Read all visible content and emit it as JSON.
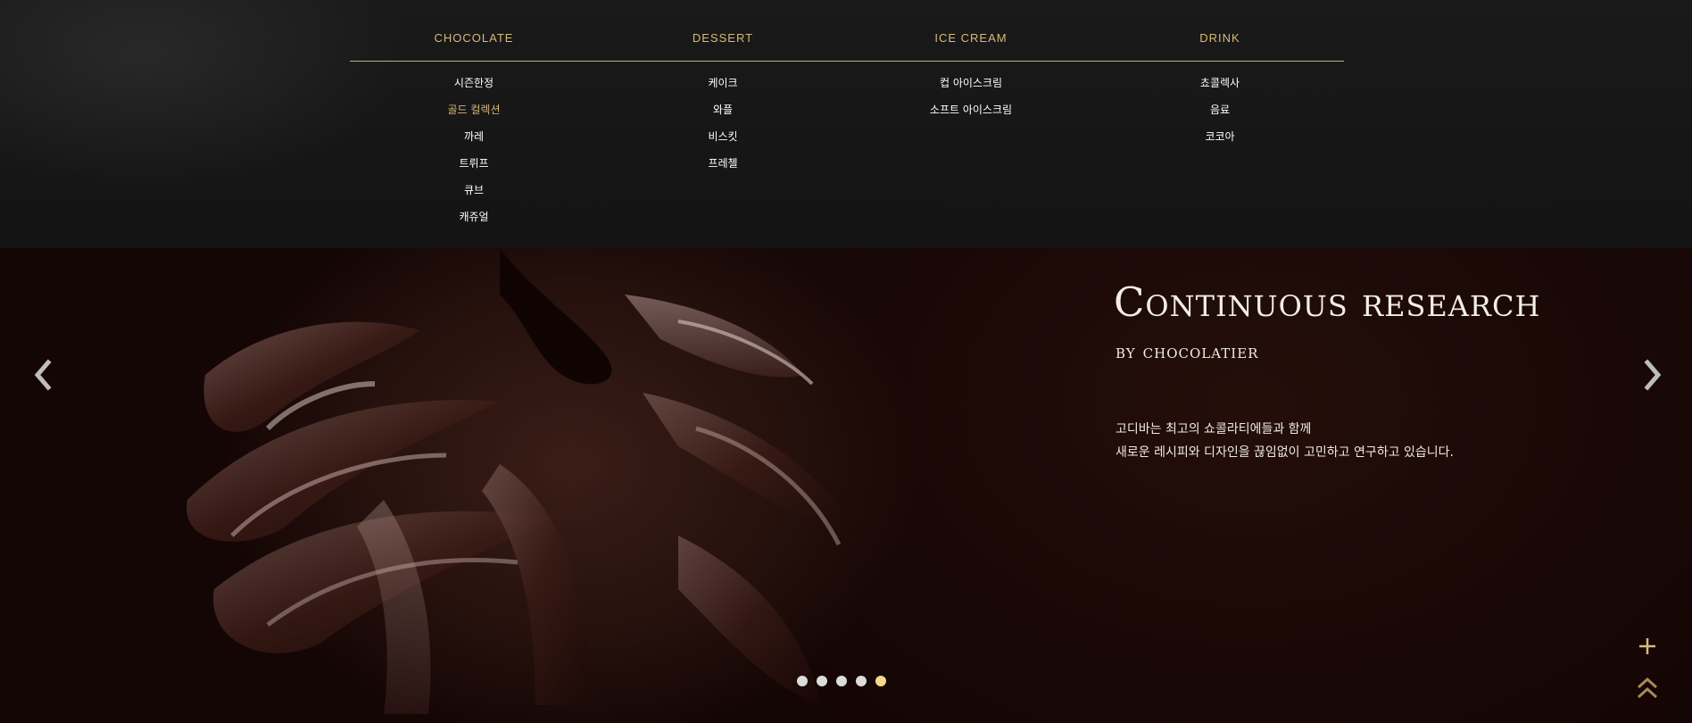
{
  "nav": {
    "columns": [
      {
        "heading": "CHOCOLATE",
        "items": [
          {
            "label": "시즌한정",
            "active": false
          },
          {
            "label": "골드 컬렉션",
            "active": true
          },
          {
            "label": "까레",
            "active": false
          },
          {
            "label": "트뤼프",
            "active": false
          },
          {
            "label": "큐브",
            "active": false
          },
          {
            "label": "캐쥬얼",
            "active": false
          }
        ]
      },
      {
        "heading": "DESSERT",
        "items": [
          {
            "label": "케이크"
          },
          {
            "label": "와플"
          },
          {
            "label": "비스킷"
          },
          {
            "label": "프레첼"
          }
        ]
      },
      {
        "heading": "ICE CREAM",
        "items": [
          {
            "label": "컵 아이스크림"
          },
          {
            "label": "소프트 아이스크림"
          }
        ]
      },
      {
        "heading": "DRINK",
        "items": [
          {
            "label": "쵸콜렉사"
          },
          {
            "label": "음료"
          },
          {
            "label": "코코아"
          }
        ]
      }
    ]
  },
  "hero": {
    "title": "Continuous research",
    "subtitle": "by chocolatier",
    "description_line1": "고디바는 최고의 쇼콜라티에들과 함께",
    "description_line2": "새로운 레시피와 디자인을 끊임없이 고민하고 연구하고 있습니다."
  },
  "slider": {
    "slide_count": 5,
    "active_index": 4
  },
  "controls": {
    "prev_icon": "chevron-left-icon",
    "next_icon": "chevron-right-icon",
    "plus_icon": "plus-icon",
    "top_icon": "double-chevron-up-icon"
  },
  "colors": {
    "accent_gold": "#d8b979",
    "dot_active": "#f3d98a",
    "menu_bg": "#161616",
    "hero_bg": "#1a0907"
  }
}
